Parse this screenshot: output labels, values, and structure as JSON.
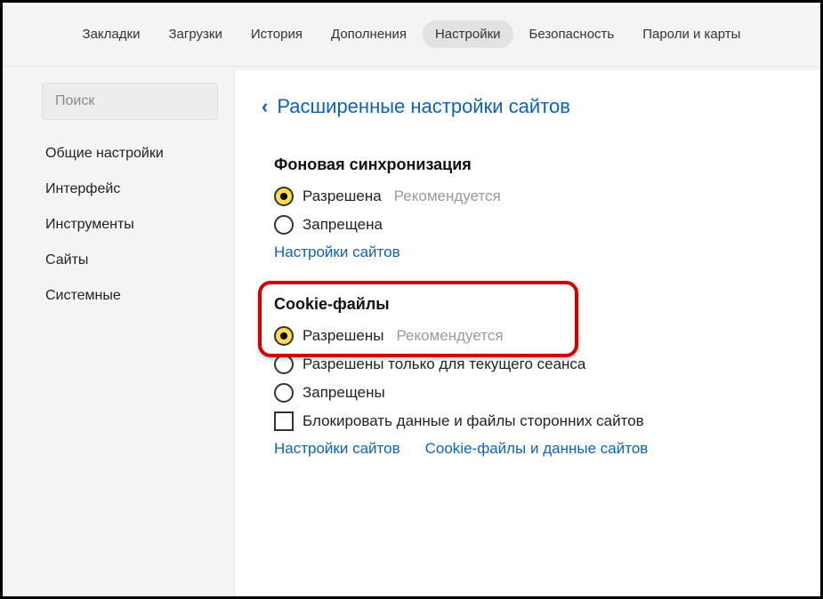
{
  "topnav": {
    "tabs": [
      {
        "label": "Закладки"
      },
      {
        "label": "Загрузки"
      },
      {
        "label": "История"
      },
      {
        "label": "Дополнения"
      },
      {
        "label": "Настройки",
        "active": true
      },
      {
        "label": "Безопасность"
      },
      {
        "label": "Пароли и карты"
      }
    ]
  },
  "sidebar": {
    "search_placeholder": "Поиск",
    "items": [
      {
        "label": "Общие настройки"
      },
      {
        "label": "Интерфейс"
      },
      {
        "label": "Инструменты"
      },
      {
        "label": "Сайты"
      },
      {
        "label": "Системные"
      }
    ]
  },
  "main": {
    "back_label": "Расширенные настройки сайтов",
    "sections": {
      "bg_sync": {
        "title": "Фоновая синхронизация",
        "opt_allowed": "Разрешена",
        "opt_allowed_hint": "Рекомендуется",
        "opt_denied": "Запрещена",
        "link_sites": "Настройки сайтов"
      },
      "cookies": {
        "title": "Cookie-файлы",
        "opt_allowed": "Разрешены",
        "opt_allowed_hint": "Рекомендуется",
        "opt_session": "Разрешены только для текущего сеанса",
        "opt_denied": "Запрещены",
        "opt_block3p": "Блокировать данные и файлы сторонних сайтов",
        "link_sites": "Настройки сайтов",
        "link_cookies": "Cookie-файлы и данные сайтов"
      }
    }
  }
}
